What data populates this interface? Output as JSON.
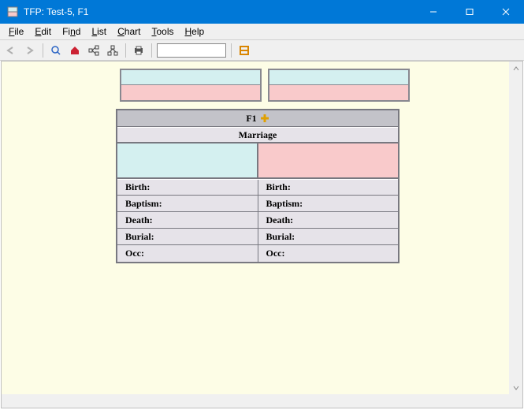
{
  "window": {
    "title": "TFP: Test-5, F1"
  },
  "menu": {
    "file": "File",
    "edit": "Edit",
    "find": "Find",
    "list": "List",
    "chart": "Chart",
    "tools": "Tools",
    "help": "Help"
  },
  "toolbar": {
    "search_value": ""
  },
  "family": {
    "id": "F1",
    "marriage_label": "Marriage",
    "fields": {
      "birth": "Birth:",
      "baptism": "Baptism:",
      "death": "Death:",
      "burial": "Burial:",
      "occ": "Occ:"
    }
  }
}
